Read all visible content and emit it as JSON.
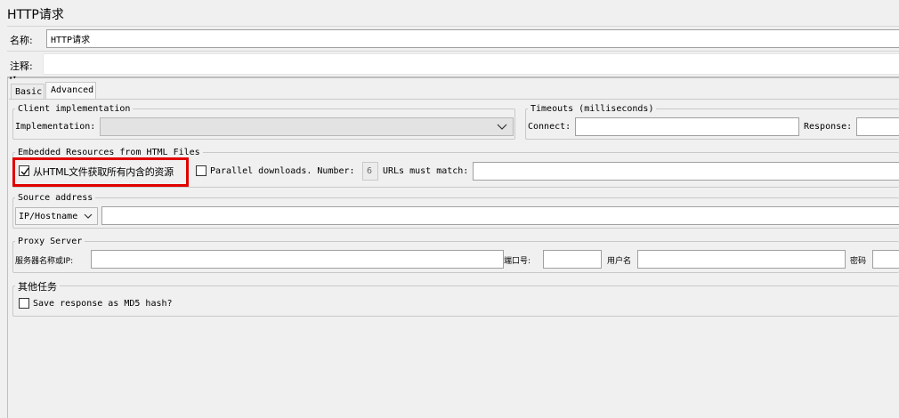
{
  "window": {
    "title": "HTTP请求"
  },
  "name_row": {
    "label": "名称:",
    "value": "HTTP请求"
  },
  "comment_row": {
    "label": "注释:",
    "value": ""
  },
  "tabs": [
    {
      "label": "Basic",
      "selected": false
    },
    {
      "label": "Advanced",
      "selected": true
    }
  ],
  "client_impl": {
    "legend": "Client implementation",
    "label": "Implementation:",
    "value": ""
  },
  "timeouts": {
    "legend": "Timeouts (milliseconds)",
    "connect_label": "Connect:",
    "connect_value": "",
    "response_label": "Response:",
    "response_value": ""
  },
  "embedded": {
    "legend": "Embedded Resources from HTML Files",
    "retrieve_label": "从HTML文件获取所有内含的资源",
    "retrieve_checked": true,
    "parallel_label": "Parallel downloads. Number:",
    "parallel_checked": false,
    "number_value": "6",
    "urls_label": "URLs must match:",
    "urls_value": "",
    "highlight_color": "#e00000"
  },
  "source": {
    "legend": "Source address",
    "select_value": "IP/Hostname",
    "address_value": ""
  },
  "proxy": {
    "legend": "Proxy Server",
    "server_label": "服务器名称或IP:",
    "port_label": "端口号:",
    "user_label": "用户名",
    "password_label": "密码"
  },
  "other": {
    "legend": "其他任务",
    "md5_label": "Save response as MD5 hash?",
    "md5_checked": false
  }
}
